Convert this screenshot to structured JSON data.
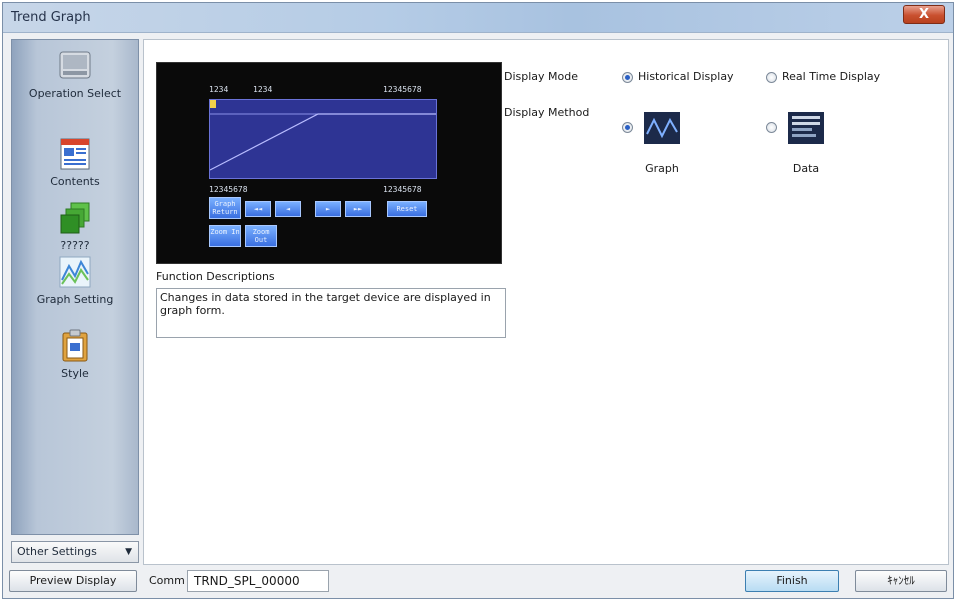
{
  "window": {
    "title": "Trend Graph",
    "close_label": "X"
  },
  "sidebar": {
    "items": [
      {
        "label": "Operation Select",
        "icon": "operation-icon"
      },
      {
        "label": "Contents",
        "icon": "contents-icon"
      },
      {
        "label": "?????",
        "icon": "layers-icon"
      },
      {
        "label": "Graph Setting",
        "icon": "graph-setting-icon"
      },
      {
        "label": "Style",
        "icon": "style-icon"
      }
    ],
    "other_settings": "Other Settings"
  },
  "preview": {
    "top_left_a": "1234",
    "top_left_b": "1234",
    "top_right": "12345678",
    "bottom_left": "12345678",
    "bottom_right": "12345678",
    "buttons": [
      "Graph Return",
      "◄◄",
      "◄",
      "►",
      "►►",
      "Reset",
      "Zoom In",
      "Zoom Out"
    ]
  },
  "function_descriptions": {
    "label": "Function Descriptions",
    "text": "Changes in data stored in the target device are displayed in graph form."
  },
  "display_mode": {
    "label": "Display Mode",
    "options": [
      {
        "label": "Historical Display",
        "selected": true
      },
      {
        "label": "Real Time Display",
        "selected": false
      }
    ]
  },
  "display_method": {
    "label": "Display Method",
    "options": [
      {
        "label": "Graph",
        "selected": true
      },
      {
        "label": "Data",
        "selected": false
      }
    ]
  },
  "footer": {
    "preview_button": "Preview Display",
    "comm_label": "Comm",
    "comm_value": "TRND_SPL_00000",
    "finish_button": "Finish",
    "cancel_button": "ｷｬﾝｾﾙ"
  },
  "colors": {
    "accent": "#3a6fe0",
    "close": "#c9502f"
  }
}
